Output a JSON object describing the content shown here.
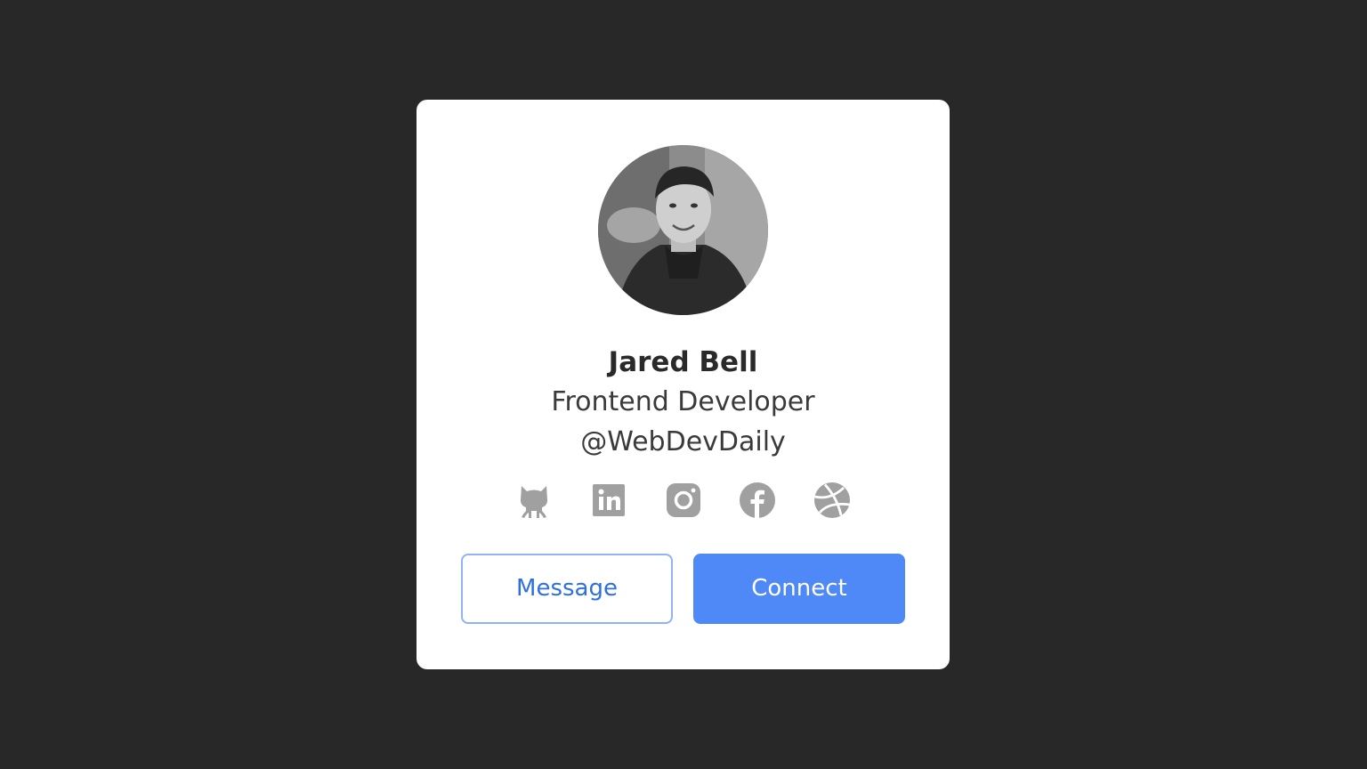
{
  "profile": {
    "name": "Jared Bell",
    "role": "Frontend Developer",
    "handle": "@WebDevDaily"
  },
  "socials": [
    {
      "icon": "github-icon"
    },
    {
      "icon": "linkedin-icon"
    },
    {
      "icon": "instagram-icon"
    },
    {
      "icon": "facebook-icon"
    },
    {
      "icon": "dribbble-icon"
    }
  ],
  "actions": {
    "message_label": "Message",
    "connect_label": "Connect"
  },
  "colors": {
    "background": "#282828",
    "card": "#ffffff",
    "accent": "#4f89f7",
    "icon": "#a0a0a0"
  }
}
